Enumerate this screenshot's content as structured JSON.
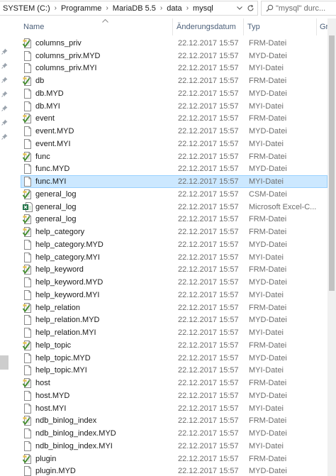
{
  "address": {
    "crumbs": [
      "SYSTEM (C:)",
      "Programme",
      "MariaDB 5.5",
      "data",
      "mysql"
    ],
    "separator": "›"
  },
  "search": {
    "placeholder": "\"mysql\" durc..."
  },
  "columns": {
    "name": "Name",
    "date": "Änderungsdatum",
    "type": "Typ",
    "size": "Gr"
  },
  "selected_index": 11,
  "files": [
    {
      "name": "columns_priv",
      "date": "22.12.2017 15:57",
      "type": "FRM-Datei",
      "icon": "frm-file-icon"
    },
    {
      "name": "columns_priv.MYD",
      "date": "22.12.2017 15:57",
      "type": "MYD-Datei",
      "icon": "blank-file-icon"
    },
    {
      "name": "columns_priv.MYI",
      "date": "22.12.2017 15:57",
      "type": "MYI-Datei",
      "icon": "blank-file-icon"
    },
    {
      "name": "db",
      "date": "22.12.2017 15:57",
      "type": "FRM-Datei",
      "icon": "frm-file-icon"
    },
    {
      "name": "db.MYD",
      "date": "22.12.2017 15:57",
      "type": "MYD-Datei",
      "icon": "blank-file-icon"
    },
    {
      "name": "db.MYI",
      "date": "22.12.2017 15:57",
      "type": "MYI-Datei",
      "icon": "blank-file-icon"
    },
    {
      "name": "event",
      "date": "22.12.2017 15:57",
      "type": "FRM-Datei",
      "icon": "frm-file-icon"
    },
    {
      "name": "event.MYD",
      "date": "22.12.2017 15:57",
      "type": "MYD-Datei",
      "icon": "blank-file-icon"
    },
    {
      "name": "event.MYI",
      "date": "22.12.2017 15:57",
      "type": "MYI-Datei",
      "icon": "blank-file-icon"
    },
    {
      "name": "func",
      "date": "22.12.2017 15:57",
      "type": "FRM-Datei",
      "icon": "frm-file-icon"
    },
    {
      "name": "func.MYD",
      "date": "22.12.2017 15:57",
      "type": "MYD-Datei",
      "icon": "blank-file-icon"
    },
    {
      "name": "func.MYI",
      "date": "22.12.2017 15:57",
      "type": "MYI-Datei",
      "icon": "blank-file-icon"
    },
    {
      "name": "general_log",
      "date": "22.12.2017 15:57",
      "type": "CSM-Datei",
      "icon": "frm-file-icon"
    },
    {
      "name": "general_log",
      "date": "22.12.2017 15:57",
      "type": "Microsoft Excel-C...",
      "icon": "excel-file-icon"
    },
    {
      "name": "general_log",
      "date": "22.12.2017 15:57",
      "type": "FRM-Datei",
      "icon": "frm-file-icon"
    },
    {
      "name": "help_category",
      "date": "22.12.2017 15:57",
      "type": "FRM-Datei",
      "icon": "frm-file-icon"
    },
    {
      "name": "help_category.MYD",
      "date": "22.12.2017 15:57",
      "type": "MYD-Datei",
      "icon": "blank-file-icon"
    },
    {
      "name": "help_category.MYI",
      "date": "22.12.2017 15:57",
      "type": "MYI-Datei",
      "icon": "blank-file-icon"
    },
    {
      "name": "help_keyword",
      "date": "22.12.2017 15:57",
      "type": "FRM-Datei",
      "icon": "frm-file-icon"
    },
    {
      "name": "help_keyword.MYD",
      "date": "22.12.2017 15:57",
      "type": "MYD-Datei",
      "icon": "blank-file-icon"
    },
    {
      "name": "help_keyword.MYI",
      "date": "22.12.2017 15:57",
      "type": "MYI-Datei",
      "icon": "blank-file-icon"
    },
    {
      "name": "help_relation",
      "date": "22.12.2017 15:57",
      "type": "FRM-Datei",
      "icon": "frm-file-icon"
    },
    {
      "name": "help_relation.MYD",
      "date": "22.12.2017 15:57",
      "type": "MYD-Datei",
      "icon": "blank-file-icon"
    },
    {
      "name": "help_relation.MYI",
      "date": "22.12.2017 15:57",
      "type": "MYI-Datei",
      "icon": "blank-file-icon"
    },
    {
      "name": "help_topic",
      "date": "22.12.2017 15:57",
      "type": "FRM-Datei",
      "icon": "frm-file-icon"
    },
    {
      "name": "help_topic.MYD",
      "date": "22.12.2017 15:57",
      "type": "MYD-Datei",
      "icon": "blank-file-icon"
    },
    {
      "name": "help_topic.MYI",
      "date": "22.12.2017 15:57",
      "type": "MYI-Datei",
      "icon": "blank-file-icon"
    },
    {
      "name": "host",
      "date": "22.12.2017 15:57",
      "type": "FRM-Datei",
      "icon": "frm-file-icon"
    },
    {
      "name": "host.MYD",
      "date": "22.12.2017 15:57",
      "type": "MYD-Datei",
      "icon": "blank-file-icon"
    },
    {
      "name": "host.MYI",
      "date": "22.12.2017 15:57",
      "type": "MYI-Datei",
      "icon": "blank-file-icon"
    },
    {
      "name": "ndb_binlog_index",
      "date": "22.12.2017 15:57",
      "type": "FRM-Datei",
      "icon": "frm-file-icon"
    },
    {
      "name": "ndb_binlog_index.MYD",
      "date": "22.12.2017 15:57",
      "type": "MYD-Datei",
      "icon": "blank-file-icon"
    },
    {
      "name": "ndb_binlog_index.MYI",
      "date": "22.12.2017 15:57",
      "type": "MYI-Datei",
      "icon": "blank-file-icon"
    },
    {
      "name": "plugin",
      "date": "22.12.2017 15:57",
      "type": "FRM-Datei",
      "icon": "frm-file-icon"
    },
    {
      "name": "plugin.MYD",
      "date": "22.12.2017 15:57",
      "type": "MYD-Datei",
      "icon": "blank-file-icon"
    }
  ],
  "colors": {
    "selection": "#cce8ff",
    "selection_border": "#99d1ff",
    "header_text": "#4c607a",
    "detail_text": "#6d6d6d"
  }
}
